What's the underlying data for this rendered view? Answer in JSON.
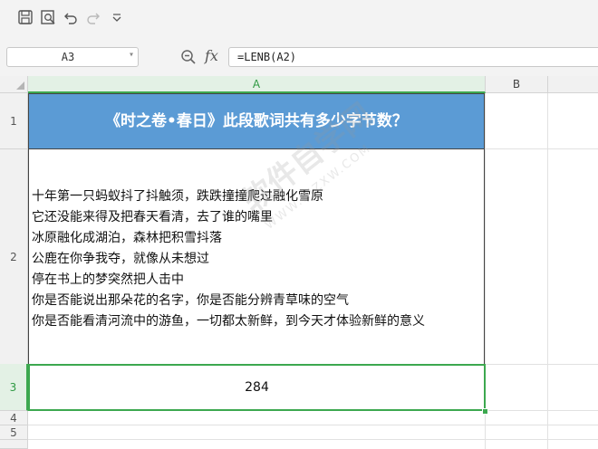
{
  "toolbar": {
    "icons": [
      "save-icon",
      "print-preview-icon",
      "undo-icon",
      "redo-icon",
      "customize-dropdown-icon"
    ]
  },
  "formula_bar": {
    "cell_reference": "A3",
    "fx_label": "fx",
    "formula": "=LENB(A2)"
  },
  "columns": [
    "A",
    "B"
  ],
  "rows": [
    "1",
    "2",
    "3",
    "4",
    "5"
  ],
  "cells": {
    "A1": "《时之卷•春日》此段歌词共有多少字节数？",
    "A2_lines": [
      "十年第一只蚂蚁抖了抖触须，跌跌撞撞爬过融化雪原",
      "它还没能来得及把春天看清，去了谁的嘴里",
      "冰原融化成湖泊，森林把积雪抖落",
      "公鹿在你争我夺，就像从未想过",
      "停在书上的梦突然把人击中",
      "你是否能说出那朵花的名字，你是否能分辨青草味的空气",
      "你是否能看清河流中的游鱼，一切都太新鲜，到今天才体验新鲜的意义"
    ],
    "A3": "284"
  },
  "watermark": {
    "text": "软件自学网",
    "url": "WWW.RJZXW.COM"
  },
  "colors": {
    "title_fill": "#5b9bd5",
    "selection_green": "#3ca84f",
    "toolbar_bg": "#f3f3f3"
  }
}
